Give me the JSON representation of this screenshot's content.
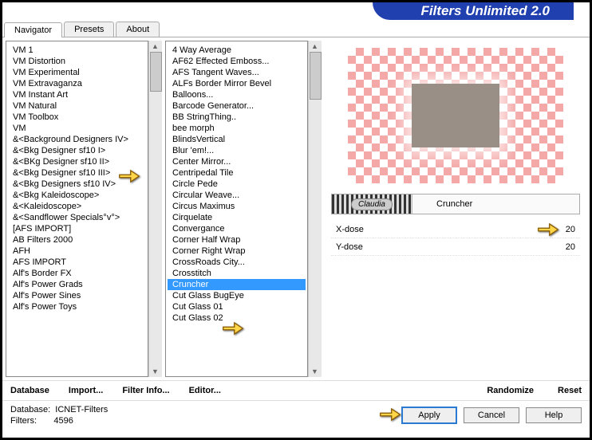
{
  "header": {
    "title": "Filters Unlimited 2.0"
  },
  "tabs": [
    {
      "label": "Navigator",
      "active": true
    },
    {
      "label": "Presets",
      "active": false
    },
    {
      "label": "About",
      "active": false
    }
  ],
  "categories": [
    "VM 1",
    "VM Distortion",
    "VM Experimental",
    "VM Extravaganza",
    "VM Instant Art",
    "VM Natural",
    "VM Toolbox",
    "VM",
    "&<Background Designers IV>",
    "&<Bkg Designer sf10 I>",
    "&<BKg Designer sf10 II>",
    "&<Bkg Designer sf10 III>",
    "&<Bkg Designers sf10 IV>",
    "&<Bkg Kaleidoscope>",
    "&<Kaleidoscope>",
    "&<Sandflower Specials°v°>",
    "[AFS IMPORT]",
    "AB Filters 2000",
    "AFH",
    "AFS IMPORT",
    "Alf's Border FX",
    "Alf's Power Grads",
    "Alf's Power Sines",
    "Alf's Power Toys"
  ],
  "category_selected_index": 9,
  "filters": [
    "4 Way Average",
    "AF62 Effected Emboss...",
    "AFS Tangent Waves...",
    "ALFs Border Mirror Bevel",
    "Balloons...",
    "Barcode Generator...",
    "BB StringThing..",
    "bee morph",
    "BlindsVertical",
    "Blur 'em!...",
    "Center Mirror...",
    "Centripedal Tile",
    "Circle Pede",
    "Circular Weave...",
    "Circus Maximus",
    "Cirquelate",
    "Convergance",
    "Corner Half Wrap",
    "Corner Right Wrap",
    "CrossRoads City...",
    "Crosstitch",
    "Cruncher",
    "Cut Glass  BugEye",
    "Cut Glass 01",
    "Cut Glass 02"
  ],
  "filter_selected_index": 21,
  "filter_name": "Cruncher",
  "logo_text": "Claudia",
  "params": [
    {
      "label": "X-dose",
      "value": 20
    },
    {
      "label": "Y-dose",
      "value": 20
    }
  ],
  "toolbar": {
    "database": "Database",
    "import": "Import...",
    "filterinfo": "Filter Info...",
    "editor": "Editor...",
    "randomize": "Randomize",
    "reset": "Reset"
  },
  "status": {
    "db_label": "Database:",
    "db_value": "ICNET-Filters",
    "filters_label": "Filters:",
    "filters_value": "4596"
  },
  "buttons": {
    "apply": "Apply",
    "cancel": "Cancel",
    "help": "Help"
  }
}
